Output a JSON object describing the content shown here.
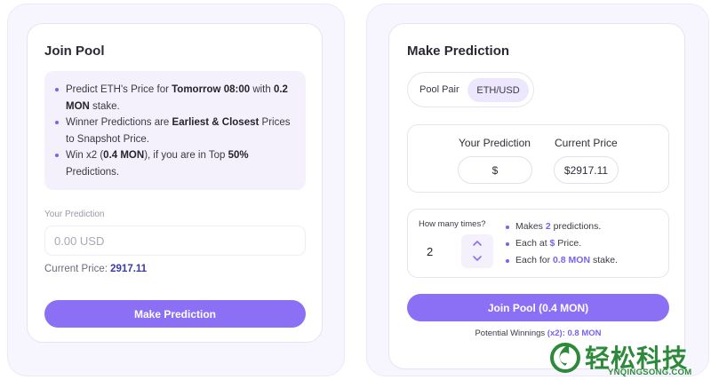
{
  "join_pool": {
    "title": "Join Pool",
    "info": [
      [
        "Predict ETH's Price for ",
        {
          "b": "Tomorrow 08:00"
        },
        " with ",
        {
          "b": "0.2 MON"
        },
        " stake."
      ],
      [
        "Winner Predictions are ",
        {
          "b": "Earliest & Closest"
        },
        " Prices to Snapshot Price."
      ],
      [
        "Win x2 (",
        {
          "b": "0.4 MON"
        },
        "), if you are in Top ",
        {
          "b": "50%"
        },
        " Predictions."
      ]
    ],
    "your_prediction_label": "Your Prediction",
    "input_placeholder": "0.00 USD",
    "current_price_label": "Current Price: ",
    "current_price_value": "2917.11",
    "button_label": "Make Prediction"
  },
  "make_prediction": {
    "title": "Make Prediction",
    "pool_pair_label": "Pool Pair",
    "pool_pair_value": "ETH/USD",
    "your_prediction_label": "Your Prediction",
    "your_prediction_value": "$",
    "current_price_label": "Current Price",
    "current_price_value": "$2917.11",
    "times_label": "How many times?",
    "times_value": "2",
    "bullets": [
      {
        "pre": "Makes ",
        "hl": "2",
        "post": " predictions."
      },
      {
        "pre": "Each at ",
        "hl": "$",
        "post": " Price."
      },
      {
        "pre": "Each for ",
        "hl": "0.8 MON",
        "post": " stake."
      }
    ],
    "join_button_label": "Join Pool (0.4 MON)",
    "potential_label": "Potential Winnings ",
    "potential_value": "(x2): 0.8 MON"
  },
  "watermark": {
    "text_cn": "轻松科技",
    "text_en": "YNQINGSONG.COM"
  },
  "colors": {
    "accent": "#8b70f5",
    "bullet": "#7b61f2",
    "watermark": "#2d8a3a"
  },
  "icons": [
    "chevron-up-icon",
    "chevron-down-icon",
    "watermark-logo-icon"
  ]
}
